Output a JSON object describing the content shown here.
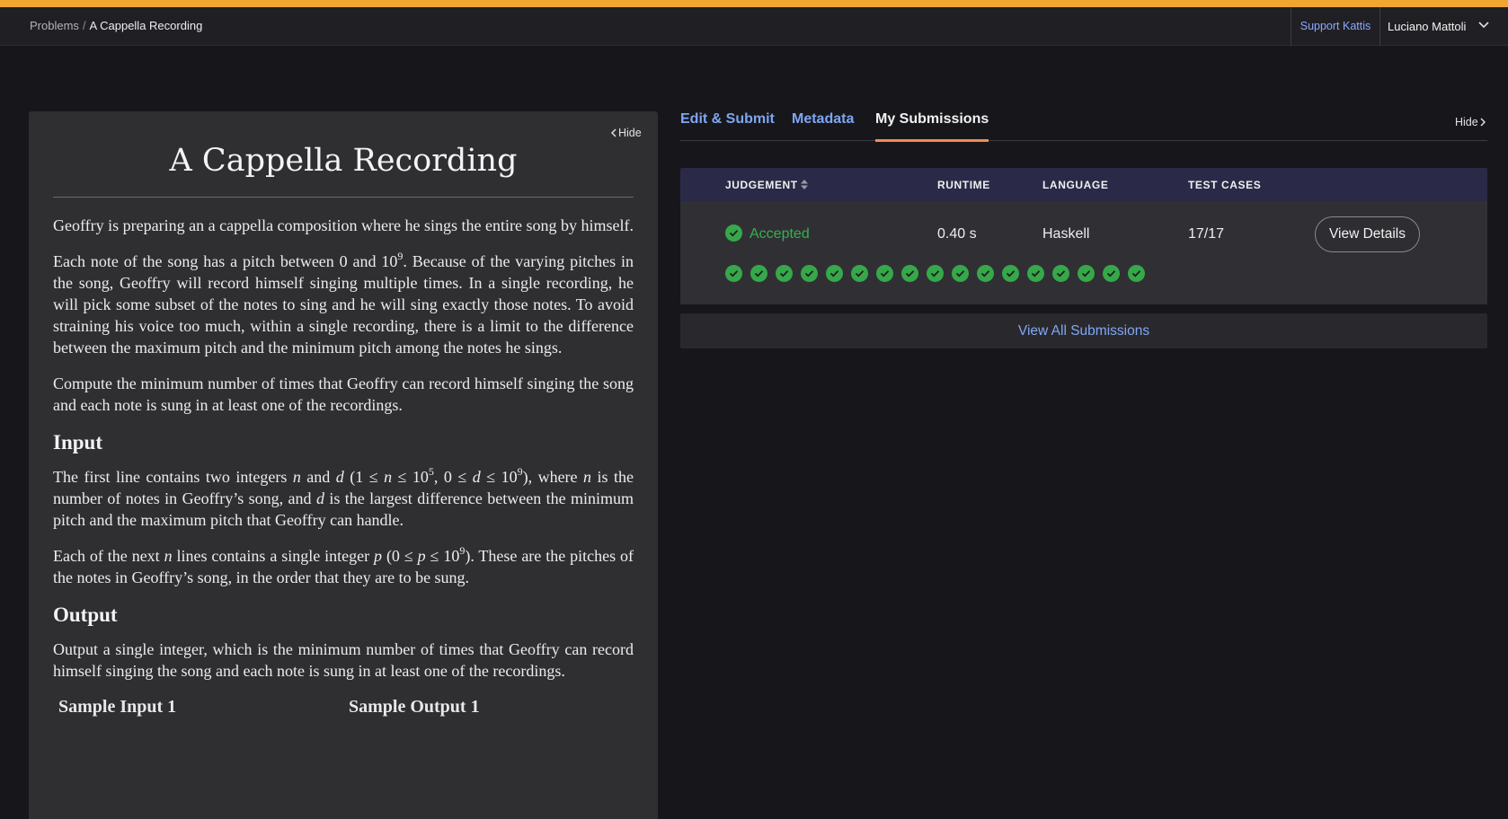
{
  "breadcrumb": {
    "root": "Problems",
    "separator": "/",
    "current": "A Cappella Recording"
  },
  "header": {
    "support_label": "Support Kattis",
    "user_name": "Luciano Mattoli"
  },
  "problem": {
    "hide_label": "Hide",
    "title": "A Cappella Recording",
    "p1": "Geoffry is preparing an a cappella composition where he sings the entire song by himself.",
    "p2": {
      "a": "Each note of the song has a pitch between 0 and 10",
      "a_exp": "9",
      "b": ". Because of the varying pitches in the song, Geoffry will record himself singing multiple times. In a single recording, he will pick some subset of the notes to sing and he will sing exactly those notes. To avoid straining his voice too much, within a single recording, there is a limit to the difference between the maximum pitch and the minimum pitch among the notes he sings."
    },
    "p3": "Compute the minimum number of times that Geoffry can record himself singing the song and each note is sung in at least one of the recordings.",
    "input_heading": "Input",
    "input_p1": {
      "a": "The first line contains two integers ",
      "n": "n",
      "b": " and ",
      "d": "d",
      "c": " (1 ≤ ",
      "n2": "n",
      "e": " ≤ 10",
      "exp1": "5",
      "f": ", 0 ≤ ",
      "d2": "d",
      "g": " ≤ 10",
      "exp2": "9",
      "h": "), where ",
      "n3": "n",
      "i": " is the number of notes in Geoffry’s song, and ",
      "d3": "d",
      "j": " is the largest difference between the minimum pitch and the maximum pitch that Geoffry can handle."
    },
    "input_p2": {
      "a": "Each of the next ",
      "n": "n",
      "b": " lines contains a single integer ",
      "p": "p",
      "c": " (0 ≤ ",
      "p2": "p",
      "d": " ≤ 10",
      "exp": "9",
      "e": "). These are the pitches of the notes in Geoffry’s song, in the order that they are to be sung."
    },
    "output_heading": "Output",
    "output_p": "Output a single integer, which is the minimum number of times that Geoffry can record himself singing the song and each note is sung in at least one of the recordings.",
    "sample_input_label": "Sample Input 1",
    "sample_output_label": "Sample Output 1"
  },
  "tabs": {
    "edit_submit": "Edit & Submit",
    "metadata": "Metadata",
    "my_submissions": "My Submissions",
    "hide_label": "Hide"
  },
  "submissions": {
    "headers": {
      "judgement": "JUDGEMENT",
      "runtime": "RUNTIME",
      "language": "LANGUAGE",
      "test_cases": "TEST CASES"
    },
    "row": {
      "judgement": "Accepted",
      "runtime": "0.40 s",
      "language": "Haskell",
      "test_cases": "17/17",
      "view_details": "View Details",
      "test_results": [
        "ok",
        "ok",
        "ok",
        "ok",
        "ok",
        "ok",
        "ok",
        "ok",
        "ok",
        "ok",
        "ok",
        "ok",
        "ok",
        "ok",
        "ok",
        "ok",
        "ok"
      ]
    },
    "view_all": "View All Submissions"
  },
  "colors": {
    "accent_stripe": "#f0a732",
    "accepted": "#35b14c",
    "link": "#7fa6f3",
    "active_tab_underline": "#f08b55"
  },
  "icons": {
    "hide_left": "chevron-left-icon",
    "hide_right": "chevron-right-icon",
    "user_menu": "chevron-down-icon",
    "sort": "sort-icon",
    "test_pass": "check-circle-icon"
  }
}
